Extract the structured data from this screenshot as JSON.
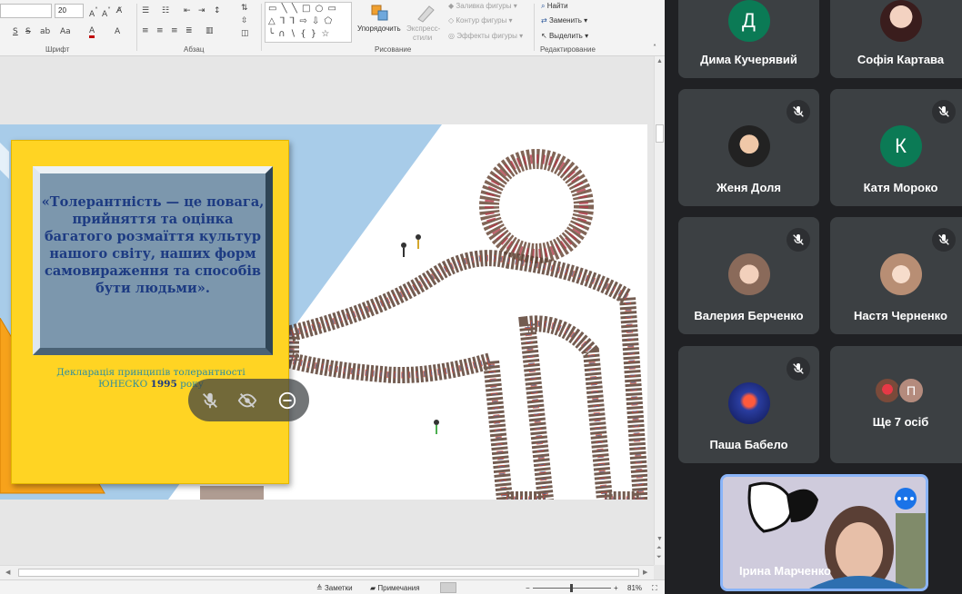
{
  "ribbon": {
    "font_name_value": "",
    "font_size_value": "20",
    "groups": {
      "font": "Шрифт",
      "paragraph": "Абзац",
      "drawing": "Рисование",
      "editing": "Редактирование"
    },
    "arrange_label": "Упорядочить",
    "quick_styles_label1": "Экспресс-",
    "quick_styles_label2": "стили",
    "shape_fill": "Заливка фигуры",
    "shape_outline": "Контур фигуры",
    "shape_effects": "Эффекты фигуры",
    "find": "Найти",
    "replace": "Заменить",
    "select": "Выделить"
  },
  "slide": {
    "quote": "«Толерантність — це повага, прийняття та оцінка багатого розмаїття культур нашого світу, наших форм самовираження та способів бути людьми».",
    "declaration_line1": "Декларація принципів толерантності",
    "declaration_org": "ЮНЕСКО",
    "declaration_year": "1995",
    "declaration_tail": "року"
  },
  "statusbar": {
    "notes": "Заметки",
    "comments": "Примечания",
    "zoom_minus": "−",
    "zoom_plus": "+",
    "zoom_level": "81%"
  },
  "participants": [
    {
      "name": "Дима Кучерявий",
      "initial": "Д",
      "avatar_color": "#0b7a55",
      "kind": "letter"
    },
    {
      "name": "Софія Картава",
      "initial": "",
      "avatar_color": "#b83245",
      "kind": "photo"
    },
    {
      "name": "Женя Доля",
      "initial": "",
      "avatar_color": "#303030",
      "kind": "photo",
      "muted": true
    },
    {
      "name": "Катя Мороко",
      "initial": "К",
      "avatar_color": "#0b7a55",
      "kind": "letter",
      "muted": true
    },
    {
      "name": "Валерия Берченко",
      "initial": "",
      "avatar_color": "#a88c7c",
      "kind": "photo",
      "muted": true
    },
    {
      "name": "Настя Черненко",
      "initial": "",
      "avatar_color": "#c7a28a",
      "kind": "photo",
      "muted": true
    },
    {
      "name": "Паша Бабело",
      "initial": "",
      "avatar_color": "#1d2f7a",
      "kind": "photo",
      "muted": true
    }
  ],
  "others": {
    "label": "Ще 7 осіб",
    "mini_initial": "П",
    "mini_color": "#b48b7d"
  },
  "presenter": {
    "name": "Ірина Марченко",
    "border_color": "#8ab4f8"
  },
  "colors": {
    "meet_bg": "#202124",
    "tile_bg": "#3c4043",
    "accent_blue": "#1a73e8"
  }
}
